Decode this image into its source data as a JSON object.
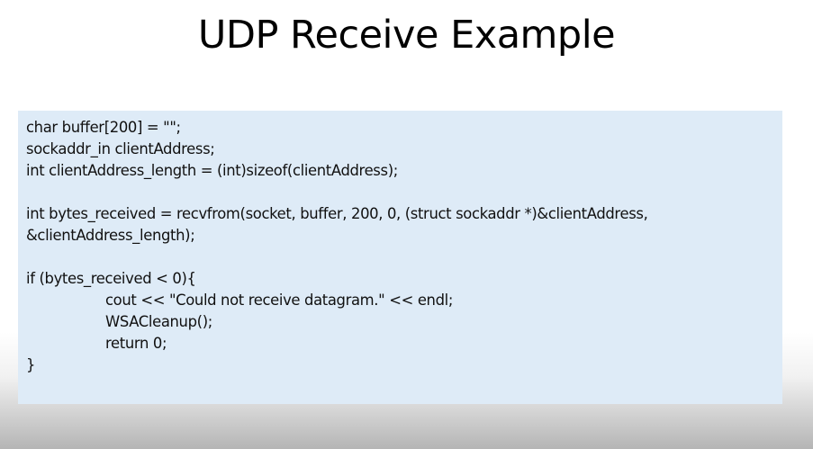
{
  "slide": {
    "title": "UDP Receive Example"
  },
  "code": {
    "lines": [
      "char buffer[200] = \"\";",
      "sockaddr_in clientAddress;",
      "int clientAddress_length = (int)sizeof(clientAddress);",
      "",
      "int bytes_received = recvfrom(socket, buffer, 200, 0, (struct sockaddr *)&clientAddress,",
      "&clientAddress_length);",
      "",
      "if (bytes_received < 0){",
      "cout << \"Could not receive datagram.\" << endl;",
      "WSACleanup();",
      "return 0;",
      "}"
    ]
  },
  "colors": {
    "code_background": "#deebf7"
  }
}
